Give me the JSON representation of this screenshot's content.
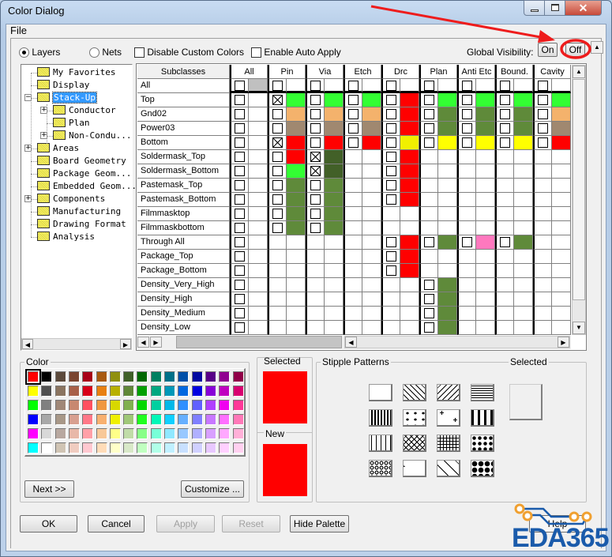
{
  "window": {
    "title": "Color Dialog",
    "menu": [
      "File"
    ]
  },
  "options": {
    "layers_label": "Layers",
    "nets_label": "Nets",
    "layers_selected": true,
    "disable_custom_colors_label": "Disable Custom Colors",
    "enable_auto_apply_label": "Enable Auto Apply",
    "global_visibility_label": "Global Visibility:",
    "on_label": "On",
    "off_label": "Off"
  },
  "tree": [
    {
      "label": "My Favorites",
      "level": 0,
      "expander": ""
    },
    {
      "label": "Display",
      "level": 0,
      "expander": ""
    },
    {
      "label": "Stack-Up",
      "level": 0,
      "expander": "-",
      "selected": true
    },
    {
      "label": "Conductor",
      "level": 1,
      "expander": "+"
    },
    {
      "label": "Plan",
      "level": 1,
      "expander": ""
    },
    {
      "label": "Non-Condu...",
      "level": 1,
      "expander": "+"
    },
    {
      "label": "Areas",
      "level": 0,
      "expander": "+"
    },
    {
      "label": "Board Geometry",
      "level": 0,
      "expander": ""
    },
    {
      "label": "Package Geom...",
      "level": 0,
      "expander": ""
    },
    {
      "label": "Embedded Geom...",
      "level": 0,
      "expander": ""
    },
    {
      "label": "Components",
      "level": 0,
      "expander": "+"
    },
    {
      "label": "Manufacturing",
      "level": 0,
      "expander": ""
    },
    {
      "label": "Drawing Format",
      "level": 0,
      "expander": ""
    },
    {
      "label": "Analysis",
      "level": 0,
      "expander": ""
    }
  ],
  "grid": {
    "subclass_header": "Subclasses",
    "columns": [
      "All",
      "Pin",
      "Via",
      "Etch",
      "Drc",
      "Plan",
      "Anti Etc",
      "Bound.",
      "Cavity"
    ],
    "cell_legend": "'-' no checkbox; 'o' unchecked; 'x' checked; ':' followed by color",
    "rows": [
      {
        "name": "All",
        "cells": [
          "o:#c0c0c0",
          "o",
          "o",
          "o",
          "o",
          "o",
          "o",
          "o",
          "o"
        ]
      },
      {
        "name": "Top",
        "cells": [
          "o",
          "x:#33ff33",
          "o:#33ff33",
          "o:#33ff33",
          "o:#ff0000",
          "o:#33ff33",
          "o:#33ff33",
          "o:#33ff33",
          "o:#33ff33"
        ]
      },
      {
        "name": "Gnd02",
        "cells": [
          "o",
          "o:#f4b26c",
          "o:#f4b26c",
          "o:#f4b26c",
          "o:#ff0000",
          "o:#5f8a3a",
          "o:#5f8a3a",
          "o:#5f8a3a",
          "o:#f4b26c"
        ]
      },
      {
        "name": "Power03",
        "cells": [
          "o",
          "o:#a08870",
          "o:#a08870",
          "o:#a08870",
          "o:#ff0000",
          "o:#5f8a3a",
          "o:#5f8a3a",
          "o:#5f8a3a",
          "o:#a08870"
        ]
      },
      {
        "name": "Bottom",
        "cells": [
          "o",
          "x:#ff0000",
          "o:#ff0000",
          "o:#ff0000",
          "o:#f0f000",
          "o:#ffff00",
          "o:#ffff00",
          "o:#ffff00",
          "o:#ff0000"
        ]
      },
      {
        "name": "Soldermask_Top",
        "cells": [
          "o",
          "o:#ff0000",
          "x:#426028",
          "-",
          "o:#ff0000",
          "-",
          "-",
          "-",
          "-"
        ]
      },
      {
        "name": "Soldermask_Bottom",
        "cells": [
          "o",
          "o:#33ff33",
          "x:#426028",
          "-",
          "o:#ff0000",
          "-",
          "-",
          "-",
          "-"
        ]
      },
      {
        "name": "Pastemask_Top",
        "cells": [
          "o",
          "o:#5f8a3a",
          "o:#5f8a3a",
          "-",
          "o:#ff0000",
          "-",
          "-",
          "-",
          "-"
        ]
      },
      {
        "name": "Pastemask_Bottom",
        "cells": [
          "o",
          "o:#5f8a3a",
          "o:#5f8a3a",
          "-",
          "o:#ff0000",
          "-",
          "-",
          "-",
          "-"
        ]
      },
      {
        "name": "Filmmasktop",
        "cells": [
          "o",
          "o:#5f8a3a",
          "o:#5f8a3a",
          "-",
          "-",
          "-",
          "-",
          "-",
          "-"
        ]
      },
      {
        "name": "Filmmaskbottom",
        "cells": [
          "o",
          "o:#5f8a3a",
          "o:#5f8a3a",
          "-",
          "-",
          "-",
          "-",
          "-",
          "-"
        ]
      },
      {
        "name": "Through All",
        "cells": [
          "o",
          "-",
          "-",
          "-",
          "o:#ff0000",
          "o:#5f8a3a",
          "o:#ff78be",
          "o:#5f8a3a",
          "-"
        ]
      },
      {
        "name": "Package_Top",
        "cells": [
          "o",
          "-",
          "-",
          "-",
          "o:#ff0000",
          "-",
          "-",
          "-",
          "-"
        ]
      },
      {
        "name": "Package_Bottom",
        "cells": [
          "o",
          "-",
          "-",
          "-",
          "o:#ff0000",
          "-",
          "-",
          "-",
          "-"
        ]
      },
      {
        "name": "Density_Very_High",
        "cells": [
          "o",
          "-",
          "-",
          "-",
          "-",
          "o:#5f8a3a",
          "-",
          "-",
          "-"
        ]
      },
      {
        "name": "Density_High",
        "cells": [
          "o",
          "-",
          "-",
          "-",
          "-",
          "o:#5f8a3a",
          "-",
          "-",
          "-"
        ]
      },
      {
        "name": "Density_Medium",
        "cells": [
          "o",
          "-",
          "-",
          "-",
          "-",
          "o:#5f8a3a",
          "-",
          "-",
          "-"
        ]
      },
      {
        "name": "Density_Low",
        "cells": [
          "o",
          "-",
          "-",
          "-",
          "-",
          "o:#5f8a3a",
          "-",
          "-",
          "-"
        ]
      }
    ]
  },
  "palette": {
    "label": "Color",
    "selected_index": 0,
    "colors": [
      "#ff0000",
      "#000000",
      "#5c4a3c",
      "#7a4530",
      "#a80018",
      "#a85a10",
      "#909010",
      "#406028",
      "#006800",
      "#008060",
      "#007088",
      "#0050a8",
      "#0008a0",
      "#580088",
      "#900090",
      "#900048",
      "#ffff00",
      "#505050",
      "#8a7460",
      "#a86048",
      "#d80018",
      "#e88010",
      "#b8b000",
      "#608838",
      "#00a000",
      "#00a880",
      "#0098b8",
      "#0068e0",
      "#0000e0",
      "#8800d8",
      "#c000c0",
      "#d80070",
      "#00ff00",
      "#808080",
      "#a08878",
      "#c88870",
      "#ff5060",
      "#f09840",
      "#d8d800",
      "#80b050",
      "#00d800",
      "#00d0a0",
      "#00b8e8",
      "#3090ff",
      "#6060ff",
      "#b040ff",
      "#f000f0",
      "#ff3898",
      "#0000ff",
      "#a8a8a8",
      "#a89888",
      "#d8a090",
      "#ff7888",
      "#f8b070",
      "#f0f000",
      "#a0c878",
      "#20ff20",
      "#00f8b8",
      "#10d0ff",
      "#68b0ff",
      "#8080ff",
      "#c878ff",
      "#ff70ff",
      "#ff78b8",
      "#ff00ff",
      "#d8d8d8",
      "#b8a8a0",
      "#e8b8a8",
      "#ffa0a8",
      "#f8c898",
      "#ffff88",
      "#c0dca8",
      "#88ff88",
      "#78ffd8",
      "#90e8ff",
      "#98c8ff",
      "#b0b0ff",
      "#d8a0ff",
      "#ffa8ff",
      "#ffb0d8",
      "#00ffff",
      "#ffffff",
      "#d0c4b4",
      "#f0ccc0",
      "#ffc8d0",
      "#ffdcb8",
      "#ffffc8",
      "#d8e8c8",
      "#c0ffc0",
      "#b0ffe8",
      "#c0f0ff",
      "#c8e0ff",
      "#d0d0ff",
      "#e8c8ff",
      "#ffd0ff",
      "#ffd0f0"
    ],
    "next_label": "Next >>",
    "customize_label": "Customize ..."
  },
  "selected_panel": {
    "selected_label": "Selected",
    "new_label": "New",
    "selected_color": "#ff0000",
    "new_color": "#ff0000"
  },
  "stipple": {
    "label": "Stipple Patterns",
    "selected_label": "Selected",
    "patterns": [
      "solid",
      "diag-back",
      "diag-fwd",
      "horizontal",
      "vertical",
      "triangles",
      "plus",
      "dashes",
      "dotted-vertical",
      "crosshatch-diag",
      "grid",
      "dots",
      "circles",
      "octagon",
      "large-x",
      "diamonds"
    ]
  },
  "buttons": {
    "ok": "OK",
    "cancel": "Cancel",
    "apply": "Apply",
    "reset": "Reset",
    "hide_palette": "Hide Palette",
    "help": "Help"
  },
  "watermark": "EDA365"
}
